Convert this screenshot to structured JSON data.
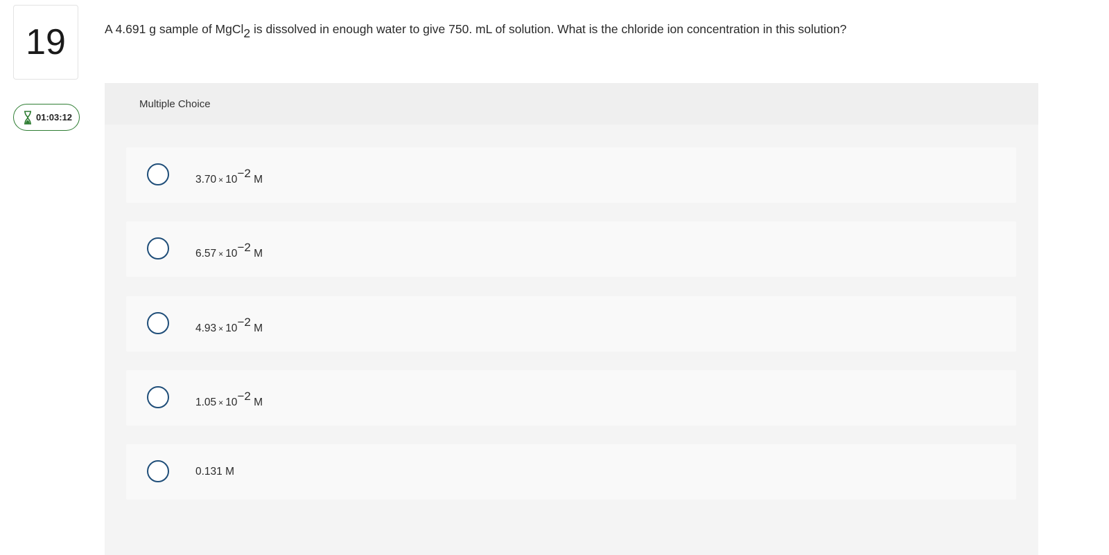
{
  "question": {
    "number": "19",
    "text_before": "A 4.691 g sample of MgCl",
    "subscript": "2",
    "text_after": " is dissolved in enough water to give 750. mL of solution. What is the chloride  ion concentration in this solution?"
  },
  "timer": {
    "icon": "hourglass-icon",
    "value": "01:03:12",
    "color": "#2e7d32"
  },
  "choices": {
    "header": "Multiple Choice",
    "options": [
      {
        "mantissa": "3.70",
        "times": "×",
        "base": "10",
        "exponent": "−2",
        "unit": "M"
      },
      {
        "mantissa": "6.57",
        "times": "×",
        "base": "10",
        "exponent": "−2",
        "unit": "M"
      },
      {
        "mantissa": "4.93",
        "times": "×",
        "base": "10",
        "exponent": "−2",
        "unit": "M"
      },
      {
        "mantissa": "1.05",
        "times": "×",
        "base": "10",
        "exponent": "−2",
        "unit": "M"
      },
      {
        "plain": "0.131 M"
      }
    ]
  },
  "colors": {
    "radio_border": "#1f4e79",
    "panel_bg": "#f4f4f4",
    "option_bg": "#f9f9f9"
  }
}
